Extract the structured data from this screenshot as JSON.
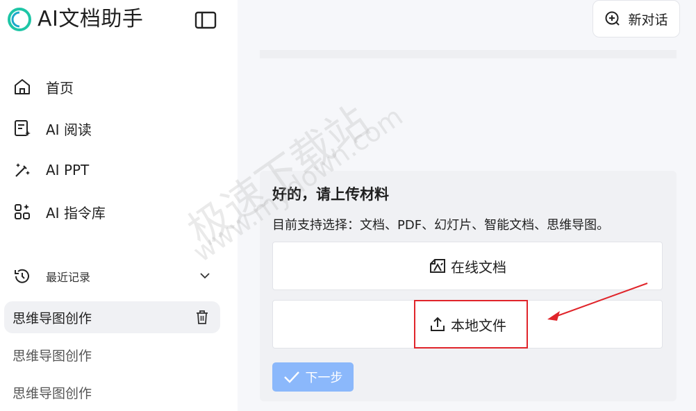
{
  "app": {
    "title": "AI文档助手"
  },
  "nav": [
    {
      "id": "home",
      "label": "首页",
      "icon": "home-icon"
    },
    {
      "id": "reading",
      "label": "AI 阅读",
      "icon": "document-sparkle-icon"
    },
    {
      "id": "ppt",
      "label": "AI PPT",
      "icon": "magic-wand-icon"
    },
    {
      "id": "commands",
      "label": "AI 指令库",
      "icon": "grid-sparkle-icon"
    }
  ],
  "history": {
    "title": "最近记录",
    "items": [
      {
        "label": "思维导图创作",
        "active": true
      },
      {
        "label": "思维导图创作",
        "active": false
      },
      {
        "label": "思维导图创作",
        "active": false
      }
    ]
  },
  "header": {
    "new_chat_label": "新对话"
  },
  "upload_card": {
    "title": "好的，请上传材料",
    "subtitle": "目前支持选择：文档、PDF、幻灯片、智能文档、思维导图。",
    "online_doc_label": "在线文档",
    "local_file_label": "本地文件",
    "next_label": "下一步"
  },
  "watermark": {
    "main": "极速下载站",
    "url": "www.mydown.com"
  },
  "colors": {
    "accent": "#8bb8fb",
    "logo": "#1ec6a6",
    "highlight": "#e0242a"
  }
}
